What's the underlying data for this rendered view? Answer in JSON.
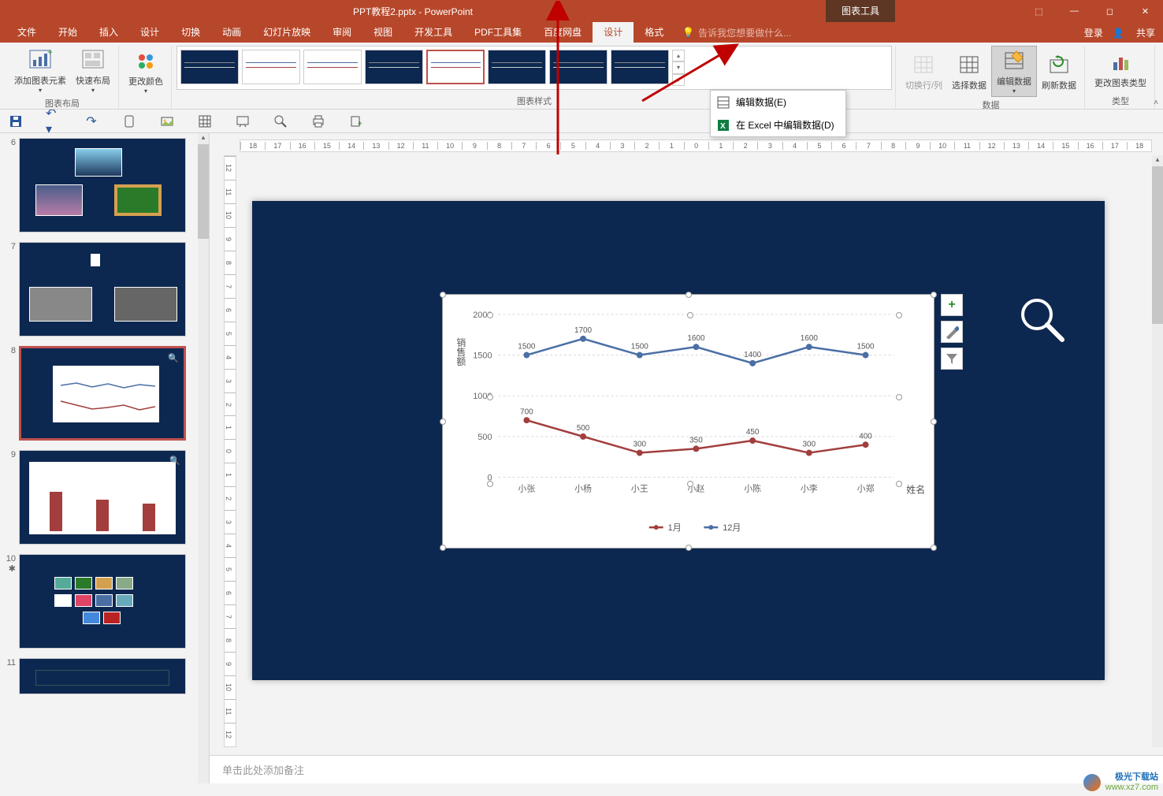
{
  "title": "PPT教程2.pptx - PowerPoint",
  "context_tab": "图表工具",
  "window_controls": {
    "options": "⬚",
    "min": "—",
    "max": "◻",
    "close": "✕"
  },
  "tabs": [
    "文件",
    "开始",
    "插入",
    "设计",
    "切换",
    "动画",
    "幻灯片放映",
    "审阅",
    "视图",
    "开发工具",
    "PDF工具集",
    "百度网盘",
    "设计",
    "格式"
  ],
  "active_tab_index": 12,
  "tell_me_placeholder": "告诉我您想要做什么...",
  "login": "登录",
  "share": "共享",
  "ribbon": {
    "layout_group": "图表布局",
    "add_element": "添加图表元素",
    "quick_layout": "快速布局",
    "change_color": "更改颜色",
    "styles_group": "图表样式",
    "switch_rc": "切换行/列",
    "select_data": "选择数据",
    "edit_data": "编辑数据",
    "refresh_data": "刷新数据",
    "data_group": "数据",
    "change_type": "更改图表类型",
    "type_group": "类型"
  },
  "dropdown": {
    "edit_data": "编辑数据(E)",
    "edit_excel": "在 Excel 中编辑数据(D)"
  },
  "qat_tips": [
    "save",
    "undo",
    "redo",
    "touch",
    "picture",
    "table",
    "shapes",
    "slideshow",
    "zoom",
    "print",
    "new-slide"
  ],
  "ruler_h": [
    "18",
    "17",
    "16",
    "15",
    "14",
    "13",
    "12",
    "11",
    "10",
    "9",
    "8",
    "7",
    "6",
    "5",
    "4",
    "3",
    "2",
    "1",
    "0",
    "1",
    "2",
    "3",
    "4",
    "5",
    "6",
    "7",
    "8",
    "9",
    "10",
    "11",
    "12",
    "13",
    "14",
    "15",
    "16",
    "17",
    "18"
  ],
  "ruler_v": [
    "12",
    "11",
    "10",
    "9",
    "8",
    "7",
    "6",
    "5",
    "4",
    "3",
    "2",
    "1",
    "0",
    "1",
    "2",
    "3",
    "4",
    "5",
    "6",
    "7",
    "8",
    "9",
    "10",
    "11",
    "12"
  ],
  "slides": [
    {
      "num": "6"
    },
    {
      "num": "7"
    },
    {
      "num": "8",
      "selected": true
    },
    {
      "num": "9"
    },
    {
      "num": "10",
      "star": true
    },
    {
      "num": "11"
    }
  ],
  "chart_data": {
    "type": "line",
    "title": "",
    "y_axis_label": "销售额",
    "x_axis_label": "姓名",
    "categories": [
      "小张",
      "小杨",
      "小王",
      "小赵",
      "小陈",
      "小李",
      "小郑"
    ],
    "y_ticks": [
      0,
      500,
      1000,
      1500,
      2000
    ],
    "series": [
      {
        "name": "1月",
        "color": "#a23e3e",
        "values": [
          700,
          500,
          300,
          350,
          450,
          300,
          400
        ]
      },
      {
        "name": "12月",
        "color": "#4a6fa5",
        "values": [
          1500,
          1700,
          1500,
          1600,
          1400,
          1600,
          1500
        ]
      }
    ],
    "ylim": [
      0,
      2000
    ]
  },
  "notes_placeholder": "单击此处添加备注",
  "watermark": {
    "brand": "极光下载站",
    "url": "www.xz7.com"
  }
}
